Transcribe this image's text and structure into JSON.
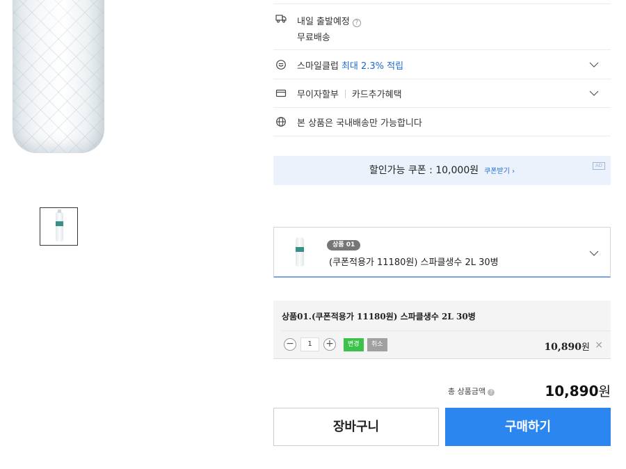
{
  "delivery": {
    "label": "내일 출발예정",
    "help": "?",
    "shipping": "무료배송"
  },
  "smile_club": {
    "prefix": "스마일클럽",
    "highlight": "최대 2.3% 적립"
  },
  "installment": {
    "label": "무이자할부",
    "card": "카드추가혜택"
  },
  "domestic": {
    "text": "본 상품은 국내배송만 가능합니다"
  },
  "coupon": {
    "text": "할인가능 쿠폰 : 10,000원",
    "get": "쿠폰받기 ›",
    "ad": "AD"
  },
  "option_select": {
    "badge": "상품 01",
    "name": "(쿠폰적용가 11180원) 스파클생수 2L 30병"
  },
  "selected_option": {
    "title": "상품01.(쿠폰적용가 11180원) 스파클생수 2L 30병",
    "minus": "−",
    "quantity": "1",
    "plus": "+",
    "change": "변경",
    "cancel": "취소",
    "price": "10,890",
    "won": "원",
    "remove": "×"
  },
  "total": {
    "label": "총 상품금액",
    "info": "?",
    "amount": "10,890",
    "won": "원"
  },
  "buttons": {
    "cart": "장바구니",
    "buy": "구매하기"
  },
  "colors": {
    "accent_blue": "#2b86f0",
    "link_blue": "#1e6ad6",
    "change_green": "#3cc24a",
    "cancel_gray": "#a0a0a0"
  }
}
